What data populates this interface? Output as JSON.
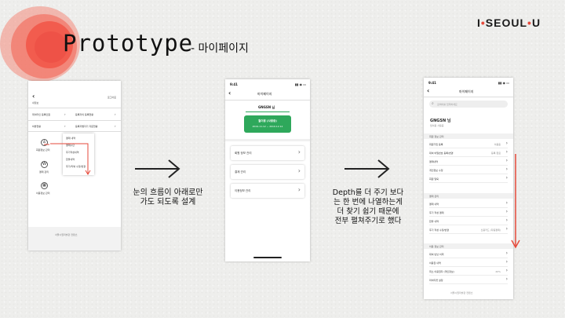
{
  "title": "Prototype",
  "subtitle": "- 마이페이지",
  "logo": {
    "left": "I",
    "middle": "SEOUL",
    "right": "U"
  },
  "captions": {
    "left": [
      "눈의 흐름이 아래로만",
      "가도 되도록 설계"
    ],
    "right": [
      "Depth를 더 주기 보다",
      "는 한 번에 나열하는게",
      "더 찾기 쉽기 때문에",
      "전부 펼쳐주기로 했다"
    ]
  },
  "colors": {
    "accent_red": "#e64a3b",
    "ticket_green": "#2ea85b"
  },
  "phone1": {
    "back": "‹",
    "logout": "로그아웃",
    "header_text": "내정보",
    "menu_rows": [
      {
        "left": "데이터인 등록인원",
        "right": "등록자의 등록현황"
      },
      {
        "left": "처방현황",
        "right": "등록자별자기 자문현황"
      }
    ],
    "icon_labels": [
      "회원정보 관리",
      "결제 관리",
      "이용정보 관리"
    ],
    "popup_items": [
      "결제 내역",
      "결제수단",
      "후기작성내역",
      "환불내역",
      "후기/리뷰 수정/변경"
    ],
    "footer": "서울시립미술관 컨텐츠"
  },
  "phone2": {
    "time": "9:41",
    "header": "마이페이지",
    "user": "GNGSN 님",
    "ticket_title": "월이용 (사용중)",
    "ticket_date": "2019.11.12 ~ 2019.12.12",
    "menus": [
      "회원 정보 관리",
      "결제 관리",
      "이용정보 관리"
    ]
  },
  "phone3": {
    "time": "9:41",
    "header": "마이페이지",
    "search_placeholder": "검색어를 입력하세요",
    "user": "GNGSN 님",
    "user_sub": "월이용 사용중",
    "sections": [
      {
        "title": "회원 정보 관리",
        "rows": [
          {
            "label": "회원가입 등록",
            "value": "이용중"
          },
          {
            "label": "대여 비밀번호 등록/변경",
            "value": "등록 완료"
          },
          {
            "label": "결제내역",
            "value": ""
          },
          {
            "label": "개인정보 수정",
            "value": ""
          },
          {
            "label": "회원 탈퇴",
            "value": ""
          }
        ]
      },
      {
        "title": "결제 관리",
        "rows": [
          {
            "label": "결제 내역",
            "value": ""
          },
          {
            "label": "후기 작성 결제",
            "value": ""
          },
          {
            "label": "환불 내역",
            "value": ""
          },
          {
            "label": "후기 작성 수정/변경",
            "value": "신용카드 (자동결제)"
          }
        ]
      },
      {
        "title": "이용 정보 관리",
        "rows": [
          {
            "label": "대여 반납 이력",
            "value": ""
          },
          {
            "label": "이용권 내역",
            "value": ""
          },
          {
            "label": "최소 이용권자 (개인정보)",
            "value": "20%"
          },
          {
            "label": "마이티켓 설정",
            "value": ""
          }
        ]
      }
    ],
    "footer": "서울시립미술관 컨텐츠"
  }
}
